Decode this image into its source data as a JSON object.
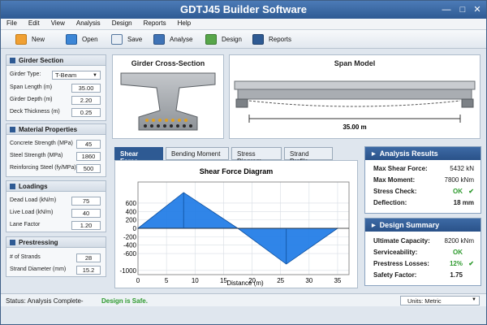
{
  "window": {
    "title": "GDTJ45 Builder Software"
  },
  "menu": [
    "File",
    "Edit",
    "View",
    "Analysis",
    "Design",
    "Reports",
    "Help"
  ],
  "toolbar": {
    "new": "New",
    "open": "Open",
    "save": "Save",
    "analyse": "Analyse",
    "design": "Design",
    "reports": "Reports"
  },
  "girder_section": {
    "title": "Girder Section",
    "type_label": "Girder Type:",
    "type_value": "T-Beam",
    "span_label": "Span Length (m)",
    "span_value": "35.00",
    "depth_label": "Girder Depth (m)",
    "depth_value": "2.20",
    "deck_label": "Deck Thickness (m)",
    "deck_value": "0.25"
  },
  "material": {
    "title": "Material Properties",
    "concrete_label": "Concrete Strength (MPa)",
    "concrete_value": "45",
    "steel_label": "Steel Strength (MPa)",
    "steel_value": "1860",
    "reinf_label": "Reinforcing Steel (fy/MPa)",
    "reinf_value": "500"
  },
  "loadings": {
    "title": "Loadings",
    "dead_label": "Dead Load (kN/m)",
    "dead_value": "75",
    "live_label": "Live Load (kN/m)",
    "live_value": "40",
    "lane_label": "Lane Factor",
    "lane_value": "1.20"
  },
  "prestressing": {
    "title": "Prestressing",
    "strands_label": "# of Strands",
    "strands_value": "28",
    "dia_label": "Strand Diameter (mm)",
    "dia_value": "15.2"
  },
  "cross_section": {
    "title": "Girder Cross-Section"
  },
  "span_model": {
    "title": "Span Model",
    "dimension": "35.00 m"
  },
  "tabs": [
    "Shear Force",
    "Bending Moment",
    "Stress Diagram",
    "Strand Profile"
  ],
  "chart_data": {
    "type": "area",
    "title": "Shear Force Diagram",
    "xlabel": "Distance (m)",
    "ylabel": "",
    "xlim": [
      0,
      37
    ],
    "ylim": [
      -1100,
      1100
    ],
    "x_ticks": [
      "0",
      "5",
      "10",
      "15",
      "20",
      "25",
      "30",
      "35"
    ],
    "y_ticks": [
      "600",
      "400",
      "200",
      "0",
      "-200",
      "-400",
      "-600",
      "-1000"
    ],
    "x": [
      0,
      8,
      17.5,
      26,
      35
    ],
    "y": [
      0,
      850,
      0,
      -850,
      0
    ],
    "fill_color": "#1e7be6",
    "grid": true
  },
  "analysis": {
    "title": "Analysis Results",
    "shear_label": "Max Shear Force:",
    "shear_value": "5432 kN",
    "moment_label": "Max Moment:",
    "moment_value": "7800 kNm",
    "stress_label": "Stress Check:",
    "stress_value": "OK",
    "defl_label": "Deflection:",
    "defl_value": "18 mm"
  },
  "design_summary": {
    "title": "Design Summary",
    "cap_label": "Ultimate Capacity:",
    "cap_value": "8200 kNm",
    "serv_label": "Serviceability:",
    "serv_value": "OK",
    "loss_label": "Prestress Losses:",
    "loss_value": "12%",
    "sf_label": "Safety Factor:",
    "sf_value": "1.75"
  },
  "status": {
    "prefix": "Status: Analysis Complete-",
    "safe": "Design is Safe.",
    "units": "Units: Metric"
  },
  "colors": {
    "accent": "#2e5a93",
    "ok": "#2e9a2e",
    "fill": "#1e7be6"
  }
}
